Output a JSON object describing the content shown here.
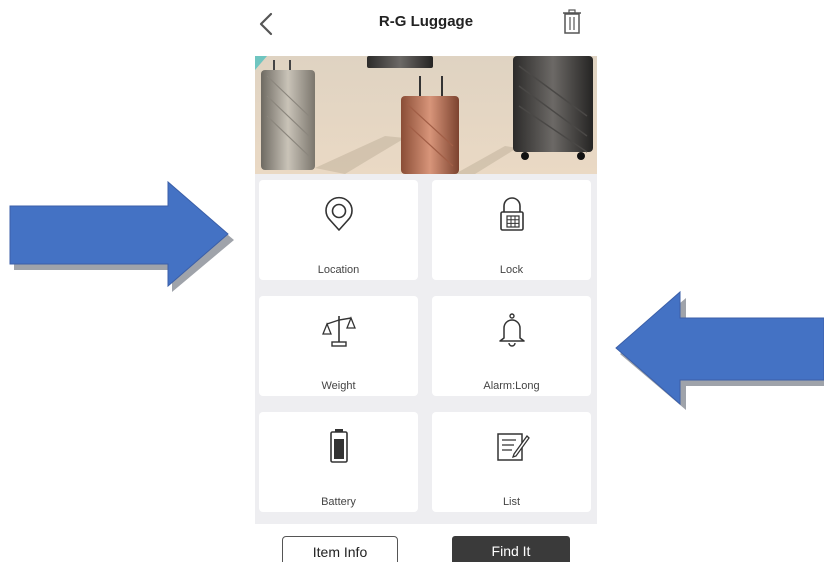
{
  "header": {
    "title": "R-G Luggage"
  },
  "tiles": [
    {
      "label": "Location",
      "icon": "location-pin-icon"
    },
    {
      "label": "Lock",
      "icon": "padlock-icon"
    },
    {
      "label": "Weight",
      "icon": "scale-icon"
    },
    {
      "label": "Alarm:Long",
      "icon": "bell-icon"
    },
    {
      "label": "Battery",
      "icon": "battery-icon"
    },
    {
      "label": "List",
      "icon": "list-edit-icon"
    }
  ],
  "footer": {
    "item_info_label": "Item Info",
    "find_it_label": "Find It"
  },
  "colors": {
    "arrow_fill": "#4472c4",
    "arrow_shadow": "#a5a5a5",
    "grid_background": "#eeeef1",
    "find_button": "#3a3a3a"
  }
}
